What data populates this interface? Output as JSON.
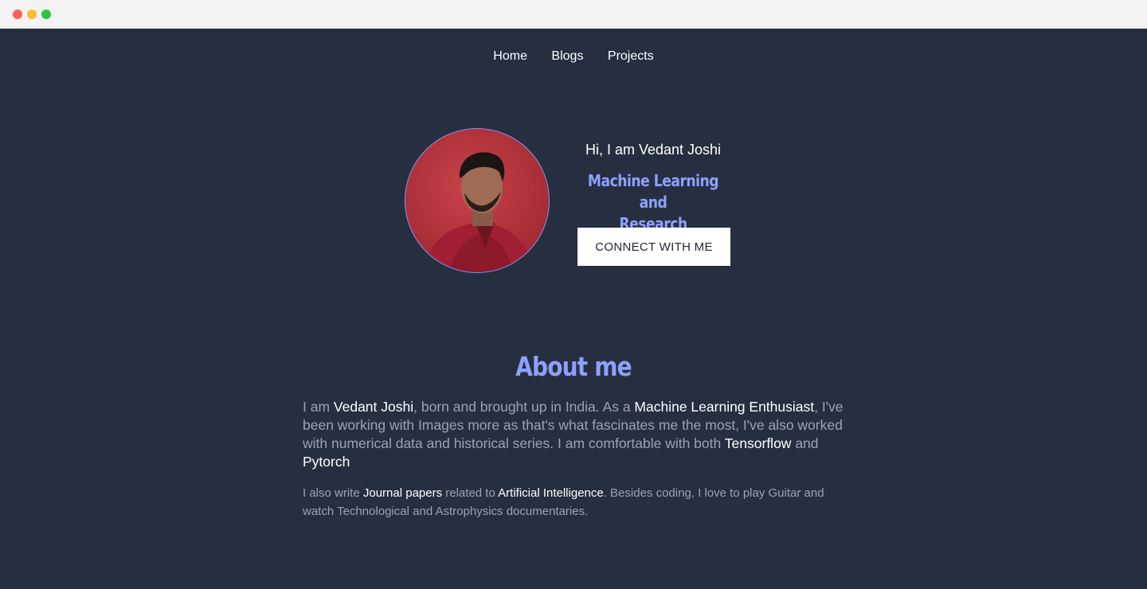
{
  "window": {
    "controls": [
      "close",
      "minimize",
      "maximize"
    ]
  },
  "nav": {
    "items": [
      "Home",
      "Blogs",
      "Projects"
    ]
  },
  "hero": {
    "greeting": "Hi, I am Vedant Joshi",
    "tagline_line1": "Machine Learning and",
    "tagline_line2": "Research Enthusiast.",
    "button_label": "CONNECT WITH ME"
  },
  "about": {
    "title": "About me",
    "p1": {
      "t1": "I am ",
      "name": "Vedant Joshi",
      "t2": ", born and brought up in India. As a ",
      "role": "Machine Learning Enthusiast",
      "t3": ", I've been working with Images more as that's what fascinates me the most, I've also worked with numerical data and historical series. I am comfortable with both ",
      "tf": "Tensorflow",
      "t4": " and ",
      "pt": "Pytorch"
    },
    "p2": {
      "t1": "I also write ",
      "journal": "Journal papers",
      "t2": " related to ",
      "ai": "Artificial Intelligence",
      "t3": ". Besides coding, I love to play Guitar and watch Technological and Astrophysics documentaries."
    }
  },
  "colors": {
    "background": "#252f40",
    "accent": "#8fa0ff",
    "text": "#ffffff",
    "muted": "#9ba3b2"
  }
}
